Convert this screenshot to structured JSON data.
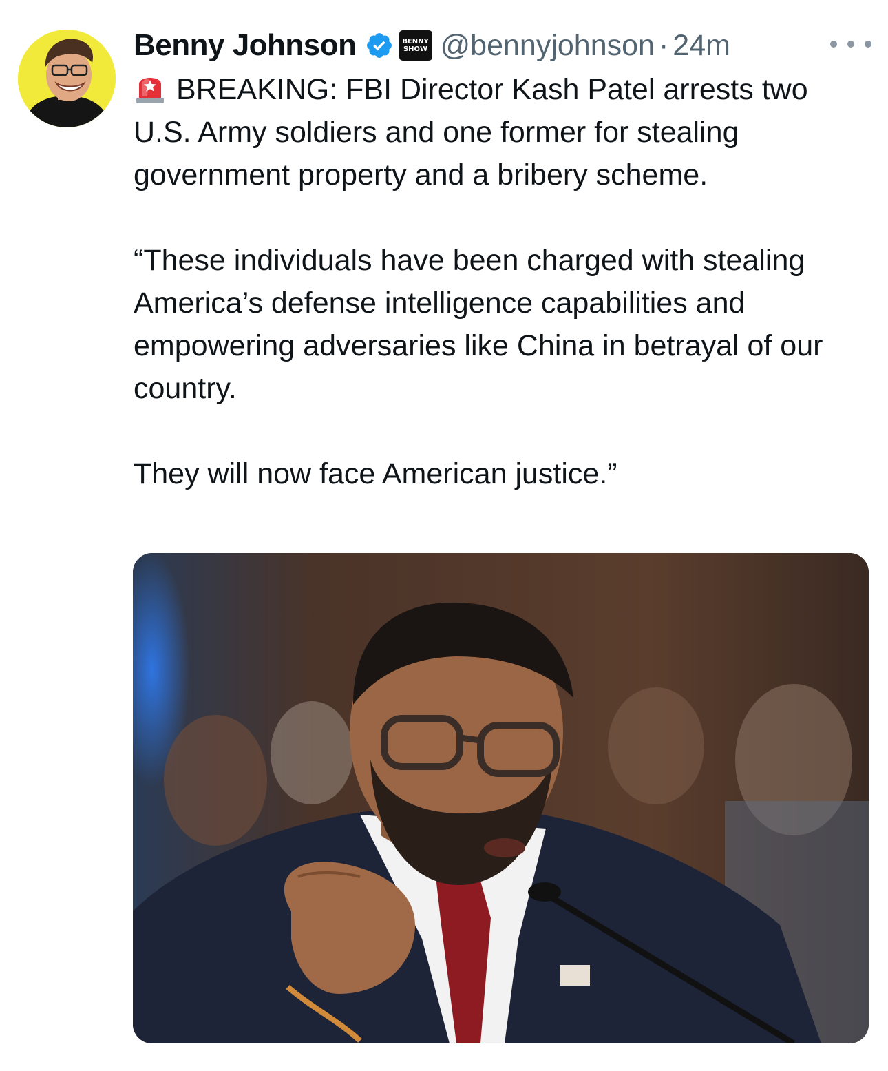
{
  "author": {
    "display_name": "Benny Johnson",
    "handle": "@bennyjohnson",
    "separator": "·",
    "timestamp": "24m",
    "affiliate_badge_lines": [
      "BENNY",
      "SHOW"
    ],
    "verified_color": "#1d9bf0",
    "avatar_background": "#f2ea3a"
  },
  "icons": {
    "more": "more-horizontal-icon",
    "verified": "verified-badge-icon",
    "siren": "rotating-light-emoji"
  },
  "tweet": {
    "line1": "BREAKING: FBI Director Kash Patel arrests two U.S. Army soldiers and one former for stealing government property and a bribery scheme.",
    "quote": "“These individuals have been charged with stealing America’s defense intelligence capabilities and empowering adversaries like China in betrayal of our country.",
    "closing": "They will now face American justice.”"
  },
  "colors": {
    "text_primary": "#0f1419",
    "text_secondary": "#536471"
  }
}
